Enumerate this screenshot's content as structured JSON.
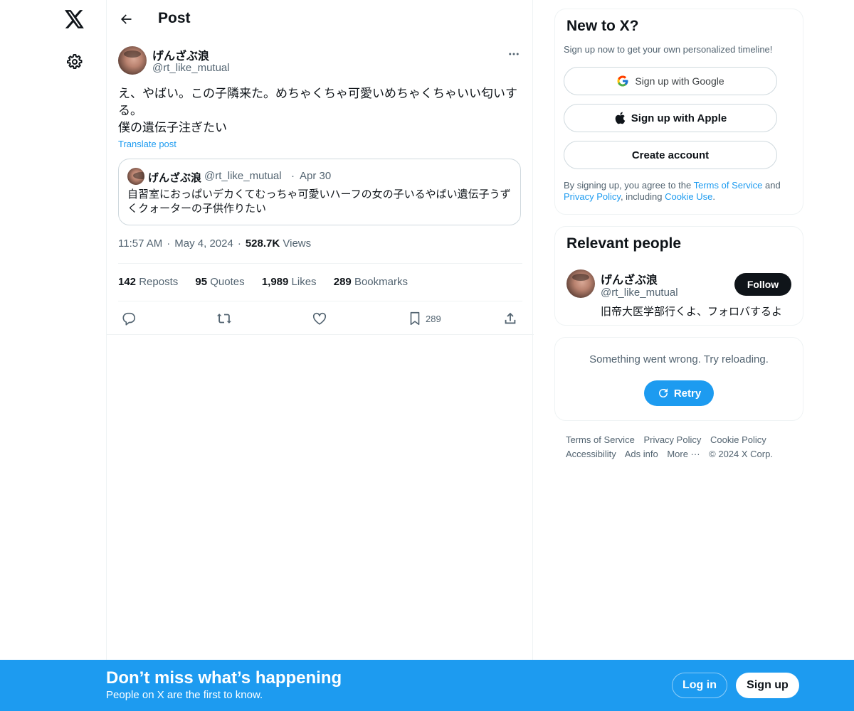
{
  "header": {
    "title": "Post"
  },
  "post": {
    "author_name": "げんざぶ浪",
    "author_handle": "@rt_like_mutual",
    "text": "え、やばい。この子隣来た。めちゃくちゃ可愛いめちゃくちゃいい匂いする。\n僕の遺伝子注ぎたい",
    "translate_label": "Translate post",
    "quote": {
      "author_name": "げんざぶ浪",
      "author_handle": "@rt_like_mutual",
      "separator": "·",
      "date": "Apr 30",
      "text": "自習室におっぱいデカくてむっちゃ可愛いハーフの女の子いるやばい遺伝子うずくクォーターの子供作りたい"
    },
    "time": "11:57 AM",
    "date": "May 4, 2024",
    "separator": "·",
    "views_count": "528.7K",
    "views_label": "Views",
    "stats": {
      "reposts_count": "142",
      "reposts_label": "Reposts",
      "quotes_count": "95",
      "quotes_label": "Quotes",
      "likes_count": "1,989",
      "likes_label": "Likes",
      "bookmarks_count": "289",
      "bookmarks_label": "Bookmarks"
    },
    "actions": {
      "bookmark_count": "289"
    }
  },
  "new_to_x": {
    "title": "New to X?",
    "subtitle": "Sign up now to get your own personalized timeline!",
    "google_label": "Sign up with Google",
    "apple_label": "Sign up with Apple",
    "create_label": "Create account",
    "legal_prefix": "By signing up, you agree to the ",
    "terms_link": "Terms of Service",
    "legal_and": " and ",
    "privacy_link": "Privacy Policy",
    "legal_including": ", including ",
    "cookie_link": "Cookie Use",
    "legal_end": "."
  },
  "relevant_people": {
    "title": "Relevant people",
    "name": "げんざぶ浪",
    "handle": "@rt_like_mutual",
    "bio": "旧帝大医学部行くよ、フォロバするよ",
    "follow_label": "Follow"
  },
  "error_card": {
    "message": "Something went wrong. Try reloading.",
    "retry_label": "Retry"
  },
  "footer": {
    "links": [
      "Terms of Service",
      "Privacy Policy",
      "Cookie Policy",
      "Accessibility",
      "Ads info",
      "More ···"
    ],
    "copyright": "© 2024 X Corp."
  },
  "bottom_bar": {
    "title": "Don’t miss what’s happening",
    "subtitle": "People on X are the first to know.",
    "login_label": "Log in",
    "signup_label": "Sign up"
  },
  "colors": {
    "accent": "#1d9bf0",
    "text": "#0f1419",
    "secondary_text": "#536471",
    "border": "#eff3f4"
  }
}
